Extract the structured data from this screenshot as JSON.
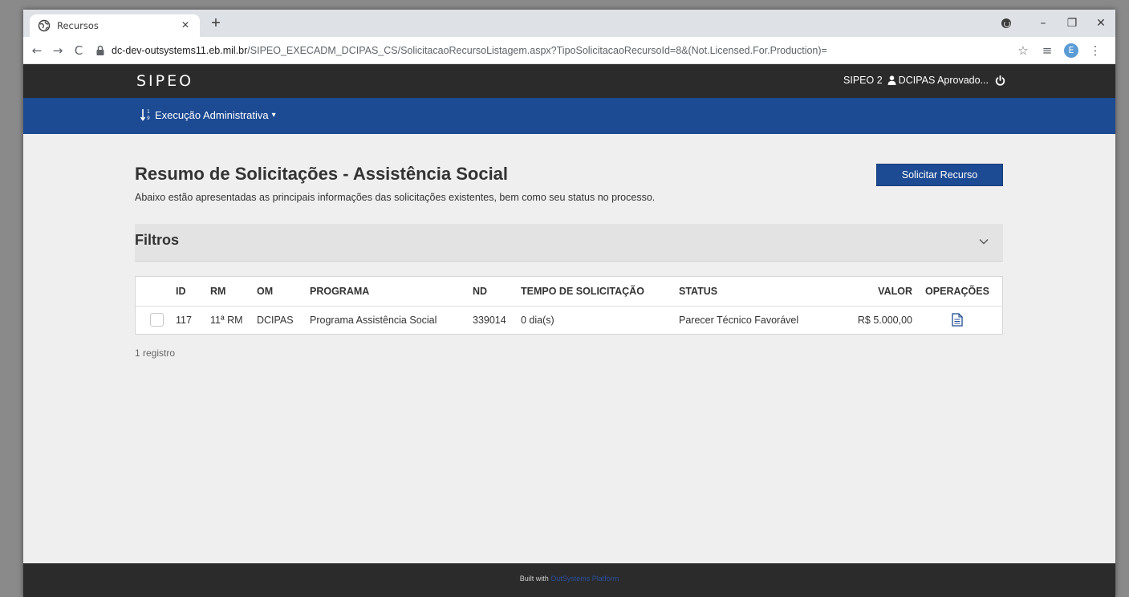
{
  "browser": {
    "tab_title": "Recursos",
    "tab_close": "×",
    "new_tab": "+",
    "url_host": "dc-dev-outsystems11.eb.mil.br",
    "url_path": "/SIPEO_EXECADM_DCIPAS_CS/SolicitacaoRecursoListagem.aspx?TipoSolicitacaoRecursoId=8&(Not.Licensed.For.Production)=",
    "profile_letter": "E",
    "window_minimize": "–",
    "window_maximize": "❐",
    "window_close": "✕",
    "back": "←",
    "forward": "→",
    "reload": "C",
    "star": "☆",
    "reading_list": "≡",
    "menu": "⋮"
  },
  "header": {
    "logo": "SIPEO",
    "system": "SIPEO 2",
    "user": "DCIPAS Aprovado..."
  },
  "menu": {
    "item": "Execução Administrativa"
  },
  "page": {
    "title": "Resumo de Solicitações - Assistência Social",
    "subtitle": "Abaixo estão apresentadas as principais informações das solicitações existentes, bem como seu status no processo.",
    "request_button": "Solicitar Recurso",
    "filters_title": "Filtros",
    "records_count": "1 registro"
  },
  "table": {
    "columns": [
      "ID",
      "RM",
      "OM",
      "PROGRAMA",
      "ND",
      "TEMPO DE SOLICITAÇÃO",
      "STATUS",
      "VALOR",
      "OPERAÇÕES"
    ],
    "rows": [
      {
        "id": "117",
        "rm": "11ª RM",
        "om": "DCIPAS",
        "programa": "Programa Assistência Social",
        "nd": "339014",
        "tempo": "0 dia(s)",
        "status": "Parecer Técnico Favorável",
        "valor": "R$ 5.000,00"
      }
    ]
  },
  "footer": {
    "built_with": "Built with",
    "platform": "OutSystems Platform"
  },
  "colors": {
    "primary_blue": "#1c4a93",
    "header_dark": "#2b2b2b",
    "page_bg": "#efefef"
  }
}
